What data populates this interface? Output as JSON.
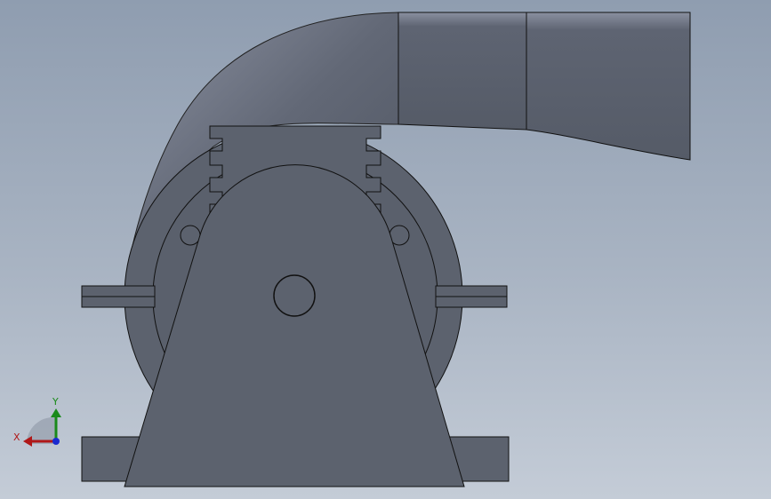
{
  "viewport": {
    "background_top": "#8f9db0",
    "background_bottom": "#c4ccd7"
  },
  "model": {
    "body_color": "#5c626e",
    "highlight_color": "#7a8090",
    "outline_color": "#111111"
  },
  "triad": {
    "x_label": "X",
    "y_label": "Y",
    "x_color": "#b01818",
    "y_color": "#1a8a1a",
    "z_color": "#1a2ad0"
  }
}
